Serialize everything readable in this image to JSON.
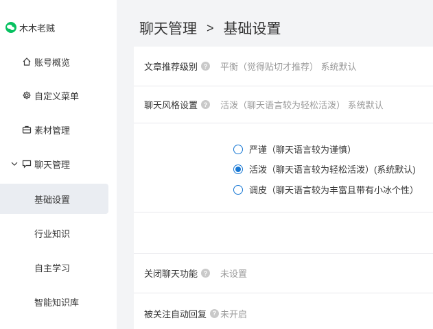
{
  "account": {
    "name": "木木老贼"
  },
  "sidebar": {
    "items": [
      {
        "label": "账号概览",
        "icon": "home-icon"
      },
      {
        "label": "自定义菜单",
        "icon": "gear-icon"
      },
      {
        "label": "素材管理",
        "icon": "briefcase-icon"
      },
      {
        "label": "聊天管理",
        "icon": "chat-icon"
      },
      {
        "label": "基础设置"
      },
      {
        "label": "行业知识"
      },
      {
        "label": "自主学习"
      },
      {
        "label": "智能知识库"
      }
    ]
  },
  "breadcrumb": {
    "parent": "聊天管理",
    "separator": ">",
    "current": "基础设置"
  },
  "settings": {
    "article_level": {
      "label": "文章推荐级别",
      "value": "平衡（觉得贴切才推荐） 系统默认"
    },
    "chat_style": {
      "label": "聊天风格设置",
      "value": "活泼（聊天语言较为轻松活泼） 系统默认"
    },
    "style_options": [
      {
        "label": "严谨（聊天语言较为谨慎）",
        "checked": false
      },
      {
        "label": "活泼（聊天语言较为轻松活泼）(系统默认)",
        "checked": true
      },
      {
        "label": "调皮（聊天语言较为丰富且带有小冰个性）",
        "checked": false
      }
    ],
    "close_chat": {
      "label": "关闭聊天功能",
      "value": "未设置"
    },
    "auto_reply": {
      "label": "被关注自动回复",
      "value": "未开启"
    }
  },
  "colors": {
    "accent": "#1677d4",
    "brand": "#07c160",
    "active_bg": "#eaedf2"
  }
}
